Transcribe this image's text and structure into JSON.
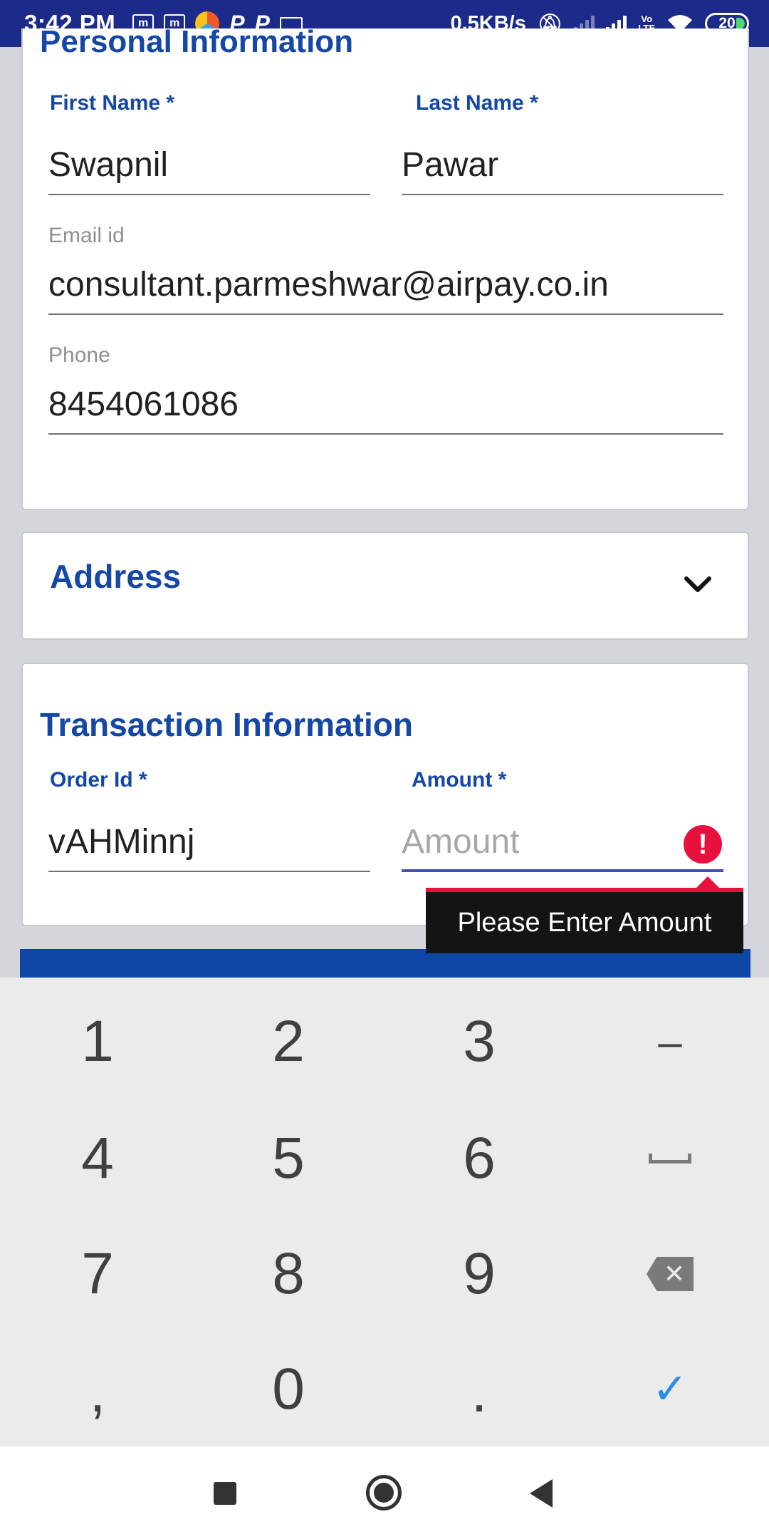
{
  "status_bar": {
    "time": "3:42 PM",
    "net_speed": "0.5KB/s",
    "battery": "20",
    "carrier_tag_1": "Vo",
    "carrier_tag_2": "LTE",
    "icons": [
      "m-icon",
      "m-icon",
      "browser-icon",
      "p-icon",
      "p-icon",
      "keyboard-icon",
      "mute-icon",
      "signal-icon",
      "wifi-icon",
      "battery-icon"
    ]
  },
  "personal": {
    "title": "Personal Information",
    "first_name_label": "First Name *",
    "first_name_value": "Swapnil",
    "last_name_label": "Last Name *",
    "last_name_value": "Pawar",
    "email_label": "Email id",
    "email_value": "consultant.parmeshwar@airpay.co.in",
    "phone_label": "Phone",
    "phone_value": "8454061086"
  },
  "address": {
    "title": "Address"
  },
  "transaction": {
    "title": "Transaction Information",
    "order_label": "Order Id *",
    "order_value": "vAHMinnj",
    "amount_label": "Amount *",
    "amount_placeholder": "Amount",
    "error_message": "Please Enter Amount",
    "error_symbol": "!"
  },
  "keypad": {
    "keys": [
      "1",
      "2",
      "3",
      "–",
      "4",
      "5",
      "6",
      "",
      "7",
      "8",
      "9",
      "",
      ",",
      "0",
      ".",
      "✓"
    ]
  },
  "colors": {
    "status_bar": "#1c2a8a",
    "accent_blue": "#1447a6",
    "error_red": "#e8103c",
    "active_underline": "#3f51b5"
  }
}
